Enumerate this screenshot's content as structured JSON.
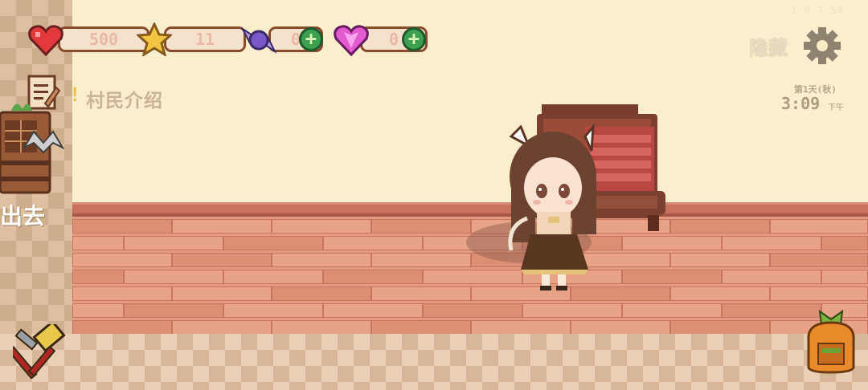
{
  "hud": {
    "hearts": "500",
    "stars": "11",
    "candy": "0",
    "gems": "0",
    "version": "1.0.7.54",
    "hide_label": "隐藏",
    "day_label": "第1天(秋)",
    "time": "3:09",
    "ampm": "下午"
  },
  "quest": {
    "mark": "!",
    "title": "村民介绍"
  },
  "exit": {
    "label": "出去"
  },
  "colors": {
    "heart": "#e23a3a",
    "star": "#f3c342",
    "candy": "#7a58c8",
    "gem": "#e15bd1",
    "plus": "#3da04e",
    "bar_border": "#8a4b2c"
  },
  "icons": [
    "heart-icon",
    "star-icon",
    "candy-icon",
    "gem-icon",
    "plus-icon",
    "gear-icon",
    "clipboard-icon",
    "door-icon",
    "bat-icon",
    "hammer-icon",
    "backpack-icon"
  ]
}
